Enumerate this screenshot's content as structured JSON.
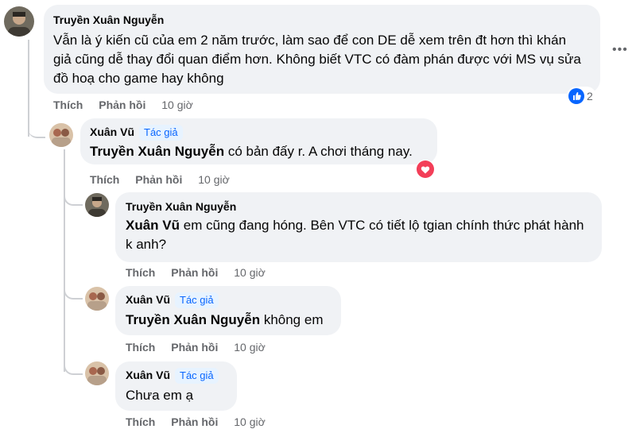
{
  "comments": [
    {
      "author": "Truyền Xuân Nguyễn",
      "text": "Vẫn là ý kiến cũ của em 2 năm trước, làm sao để con DE dễ xem trên đt hơn thì khán giả cũng dễ thay đổi quan điểm hơn. Không biết VTC có đàm phán được với MS vụ sửa đồ hoạ cho game hay không",
      "like_label": "Thích",
      "reply_label": "Phản hồi",
      "time": "10 giờ",
      "reaction": {
        "icon": "like-icon",
        "count": "2"
      }
    },
    {
      "author": "Xuân Vũ",
      "badge": "Tác giả",
      "mention": "Truyền Xuân Nguyễn",
      "text": " có bản đấy r. A chơi tháng nay.",
      "like_label": "Thích",
      "reply_label": "Phản hồi",
      "time": "10 giờ",
      "reaction": {
        "icon": "heart-icon"
      }
    },
    {
      "author": "Truyền Xuân Nguyễn",
      "mention": "Xuân Vũ",
      "text": " em cũng đang hóng. Bên VTC có tiết lộ tgian chính thức phát hành k anh?",
      "like_label": "Thích",
      "reply_label": "Phản hồi",
      "time": "10 giờ"
    },
    {
      "author": "Xuân Vũ",
      "badge": "Tác giả",
      "mention": "Truyền Xuân Nguyễn",
      "text": " không em",
      "like_label": "Thích",
      "reply_label": "Phản hồi",
      "time": "10 giờ"
    },
    {
      "author": "Xuân Vũ",
      "badge": "Tác giả",
      "text": "Chưa em ạ",
      "like_label": "Thích",
      "reply_label": "Phản hồi",
      "time": "10 giờ"
    }
  ],
  "colors": {
    "bubble": "#f0f2f5",
    "like_blue": "#0866ff",
    "heart_red": "#f33e58",
    "meta_gray": "#65676b",
    "thread_line": "#ced0d4"
  }
}
